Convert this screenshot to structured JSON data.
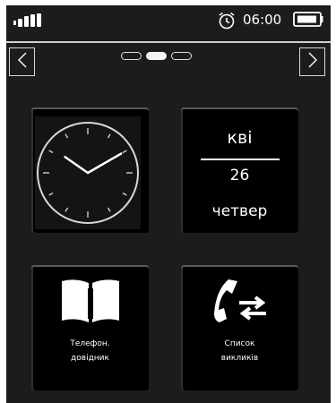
{
  "status_bar": {
    "signal_icon": "signal-strength-icon",
    "alarm_icon": "alarm-clock-icon",
    "time": "06:00",
    "battery_icon": "battery-icon"
  },
  "pager": {
    "prev_icon": "chevron-left-icon",
    "next_icon": "chevron-right-icon",
    "page_count": 3,
    "active_page": 2
  },
  "tiles": {
    "clock": {
      "icon": "analog-clock-icon",
      "hour": 10,
      "minute": 10
    },
    "date": {
      "month": "кві",
      "day": "26",
      "weekday": "четвер"
    },
    "phonebook": {
      "icon": "book-icon",
      "label": "Телефон.\nдовідник"
    },
    "calls": {
      "icon": "phone-call-list-icon",
      "label": "Список\nвикликів"
    }
  },
  "colors": {
    "background": "#1c1c1c",
    "tile": "#000000",
    "foreground": "#ffffff"
  }
}
